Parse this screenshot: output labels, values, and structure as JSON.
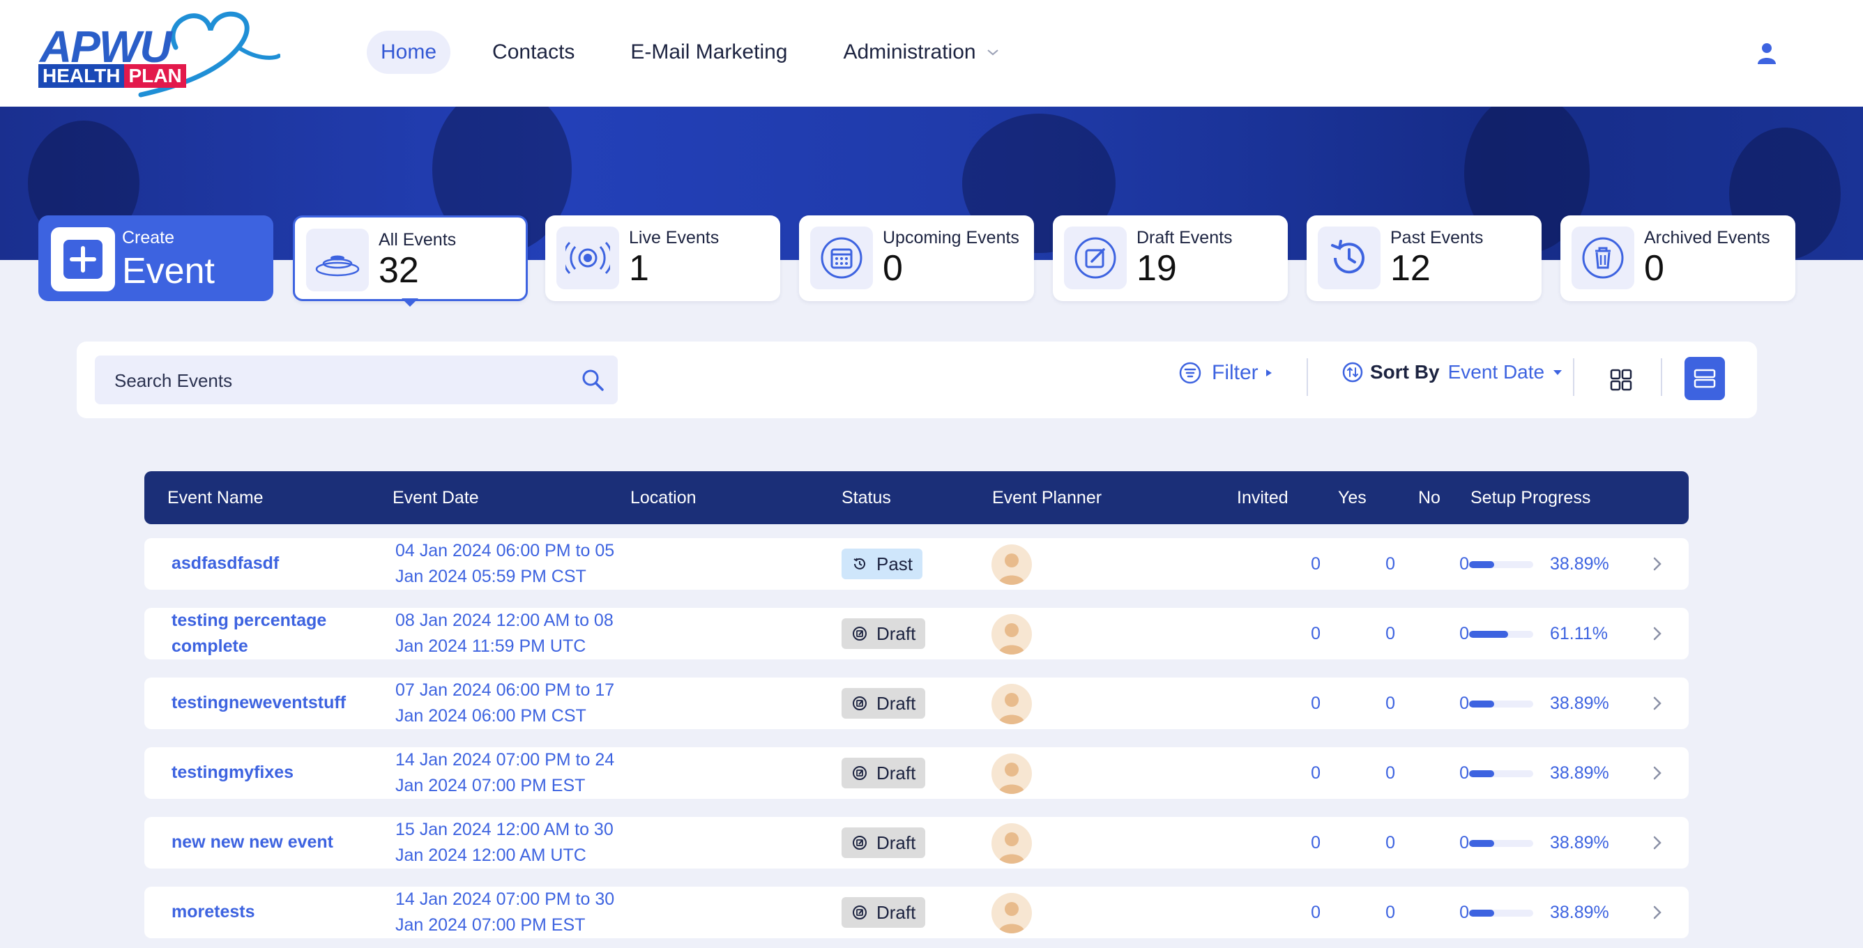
{
  "brand": {
    "logo_text_top": "APWU",
    "logo_text_health": "HEALTH",
    "logo_text_plan": "PLAN"
  },
  "nav": {
    "items": [
      {
        "label": "Home",
        "active": true
      },
      {
        "label": "Contacts"
      },
      {
        "label": "E-Mail Marketing"
      },
      {
        "label": "Administration",
        "has_dropdown": true
      }
    ],
    "user_icon": "user-icon"
  },
  "create": {
    "small": "Create",
    "big": "Event"
  },
  "tiles": [
    {
      "label": "All Events",
      "count": "32",
      "icon": "signal-waves-icon",
      "selected": true
    },
    {
      "label": "Live Events",
      "count": "1",
      "icon": "broadcast-icon"
    },
    {
      "label": "Upcoming Events",
      "count": "0",
      "icon": "calendar-icon"
    },
    {
      "label": "Draft Events",
      "count": "19",
      "icon": "edit-icon"
    },
    {
      "label": "Past Events",
      "count": "12",
      "icon": "history-icon"
    },
    {
      "label": "Archived Events",
      "count": "0",
      "icon": "trash-icon"
    }
  ],
  "toolbar": {
    "search_placeholder": "Search Events",
    "filter_label": "Filter",
    "sort_label": "Sort By",
    "sort_value": "Event Date"
  },
  "table": {
    "headers": [
      "Event Name",
      "Event Date",
      "Location",
      "Status",
      "Event Planner",
      "Invited",
      "Yes",
      "No",
      "Setup Progress"
    ],
    "rows": [
      {
        "name": "asdfasdfasdf",
        "date1": "04 Jan 2024 06:00 PM to 05",
        "date2": "Jan 2024 05:59 PM CST",
        "status": "Past",
        "invited": "0",
        "yes": "0",
        "no": "0",
        "progress": 0.3889,
        "pct": "38.89%"
      },
      {
        "name": "testing percentage complete",
        "date1": "08 Jan 2024 12:00 AM to 08",
        "date2": "Jan 2024 11:59 PM UTC",
        "status": "Draft",
        "invited": "0",
        "yes": "0",
        "no": "0",
        "progress": 0.6111,
        "pct": "61.11%"
      },
      {
        "name": "testingneweventstuff",
        "date1": "07 Jan 2024 06:00 PM to 17",
        "date2": "Jan 2024 06:00 PM CST",
        "status": "Draft",
        "invited": "0",
        "yes": "0",
        "no": "0",
        "progress": 0.3889,
        "pct": "38.89%"
      },
      {
        "name": "testingmyfixes",
        "date1": "14 Jan 2024 07:00 PM to 24",
        "date2": "Jan 2024 07:00 PM EST",
        "status": "Draft",
        "invited": "0",
        "yes": "0",
        "no": "0",
        "progress": 0.3889,
        "pct": "38.89%"
      },
      {
        "name": "new new new event",
        "date1": "15 Jan 2024 12:00 AM to 30",
        "date2": "Jan 2024 12:00 AM UTC",
        "status": "Draft",
        "invited": "0",
        "yes": "0",
        "no": "0",
        "progress": 0.3889,
        "pct": "38.89%"
      },
      {
        "name": "moretests",
        "date1": "14 Jan 2024 07:00 PM to 30",
        "date2": "Jan 2024 07:00 PM EST",
        "status": "Draft",
        "invited": "0",
        "yes": "0",
        "no": "0",
        "progress": 0.3889,
        "pct": "38.89%"
      }
    ]
  },
  "colors": {
    "accent": "#3d63e0",
    "header_bg": "#1b2f78",
    "past_badge": "#cfe6fb",
    "draft_badge": "#dcdcdc"
  }
}
